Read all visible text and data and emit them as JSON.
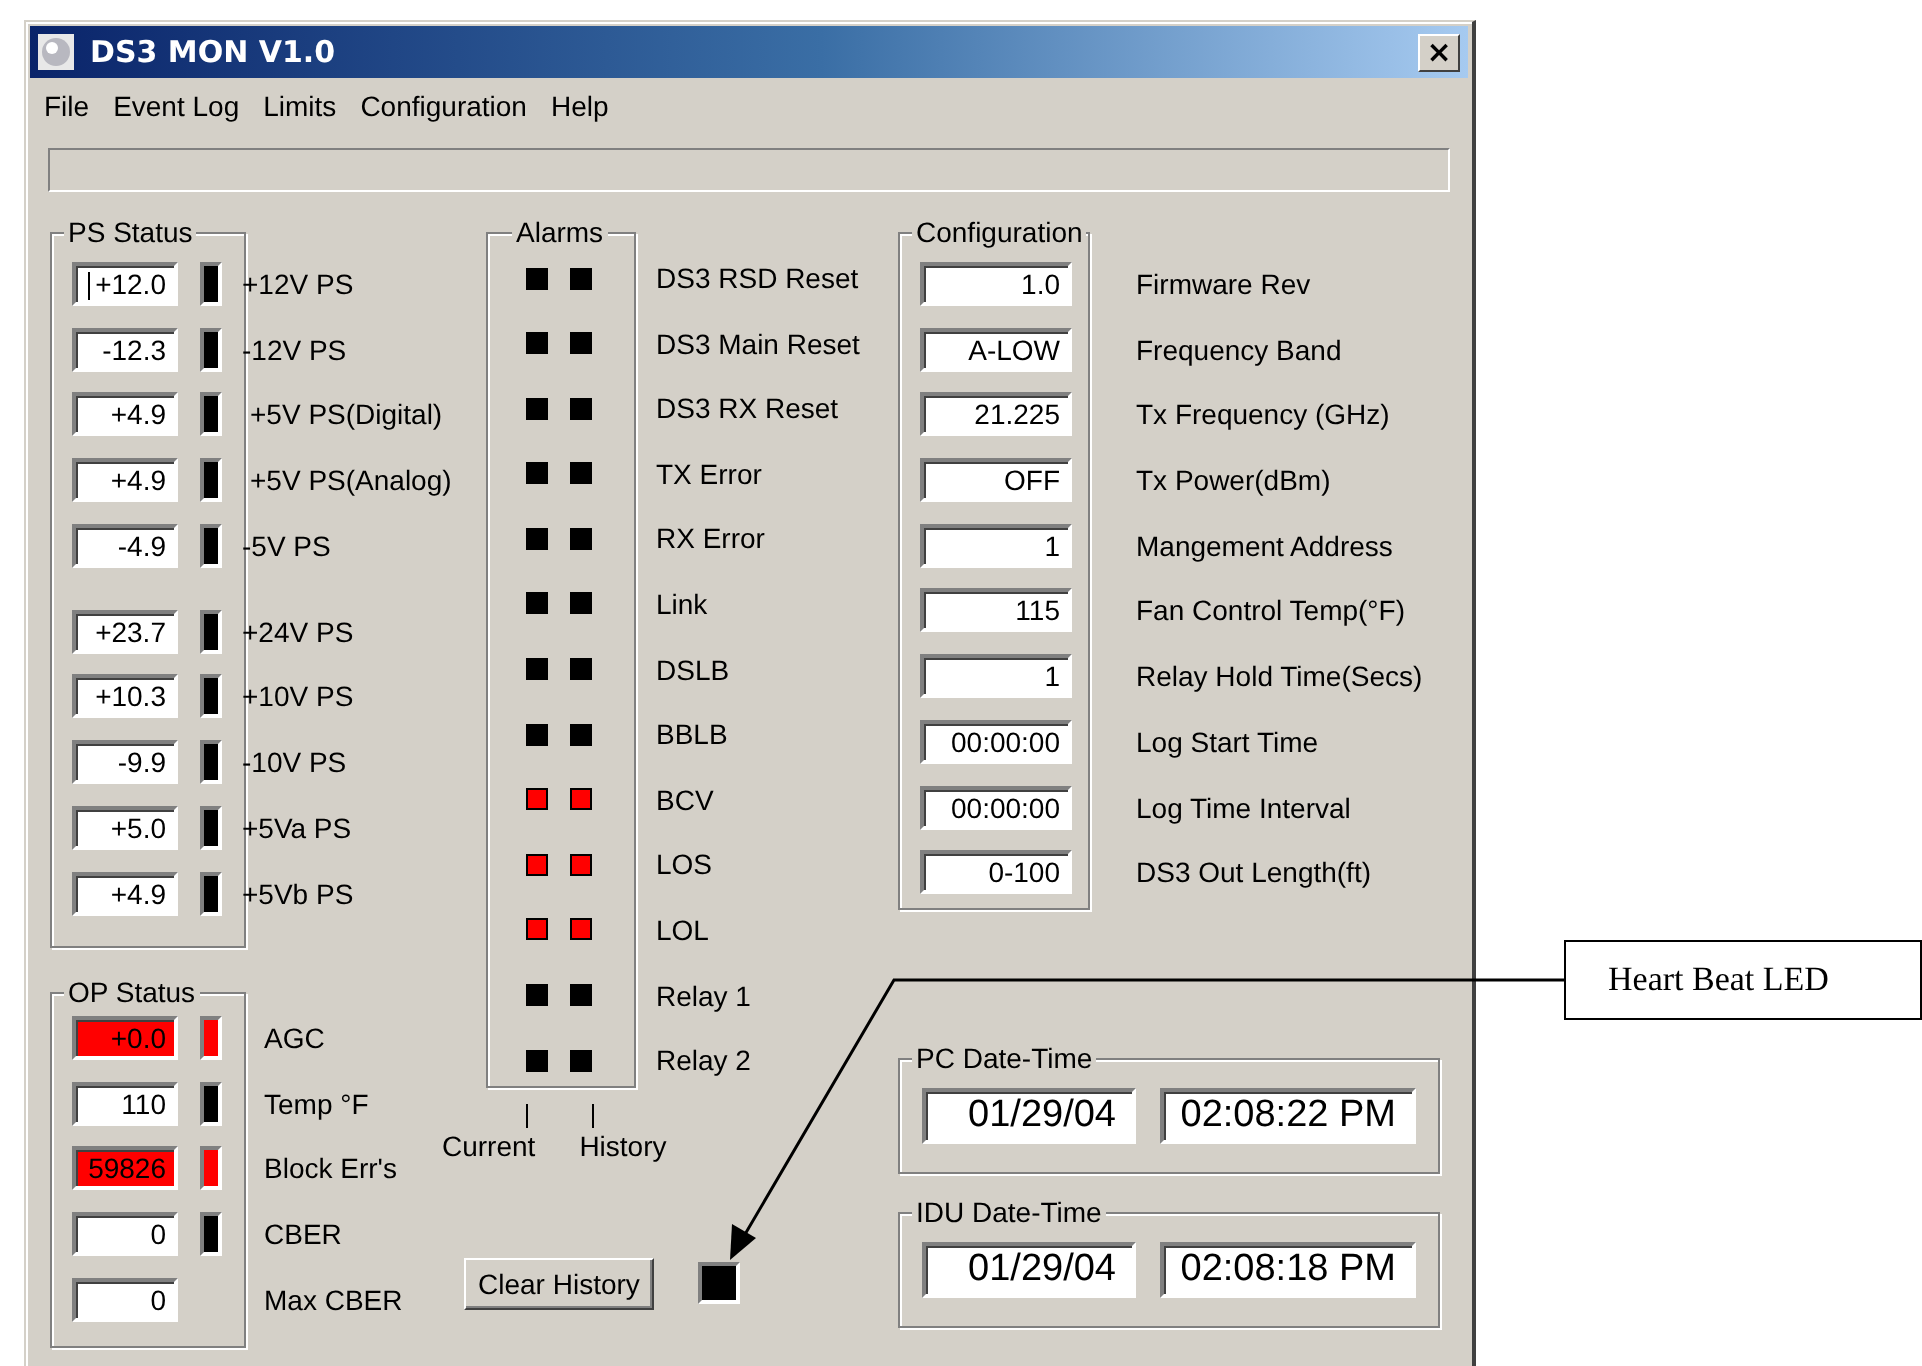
{
  "window": {
    "title": "DS3 MON V1.0",
    "close": "×"
  },
  "menu": [
    "File",
    "Event Log",
    "Limits",
    "Configuration",
    "Help"
  ],
  "ps_status": {
    "title": "PS Status",
    "banks": [
      [
        {
          "value": "+12.0",
          "label": "+12V PS",
          "alarm": false,
          "focused": true
        },
        {
          "value": "-12.3",
          "label": "-12V PS",
          "alarm": false,
          "focused": false
        },
        {
          "value": "+4.9",
          "label": "+5V PS(Digital)",
          "alarm": false,
          "focused": false
        },
        {
          "value": "+4.9",
          "label": "+5V PS(Analog)",
          "alarm": false,
          "focused": false
        },
        {
          "value": "-4.9",
          "label": "-5V PS",
          "alarm": false,
          "focused": false
        }
      ],
      [
        {
          "value": "+23.7",
          "label": "+24V PS",
          "alarm": false,
          "focused": false
        },
        {
          "value": "+10.3",
          "label": "+10V PS",
          "alarm": false,
          "focused": false
        },
        {
          "value": "-9.9",
          "label": "-10V PS",
          "alarm": false,
          "focused": false
        },
        {
          "value": "+5.0",
          "label": "+5Va PS",
          "alarm": false,
          "focused": false
        },
        {
          "value": "+4.9",
          "label": "+5Vb PS",
          "alarm": false,
          "focused": false
        }
      ]
    ]
  },
  "op_status": {
    "title": "OP Status",
    "rows": [
      {
        "kind": "led",
        "value": "+0.0",
        "label": "AGC",
        "alarm": true
      },
      {
        "kind": "led",
        "value": "110",
        "label": "Temp °F",
        "alarm": false
      },
      {
        "kind": "led",
        "value": "59826",
        "label": "Block Err's",
        "alarm": true
      },
      {
        "kind": "led",
        "value": "0",
        "label": "CBER",
        "alarm": false
      },
      {
        "kind": "plain",
        "value": "0",
        "label": "Max CBER",
        "alarm": false
      }
    ]
  },
  "alarms": {
    "title": "Alarms",
    "rows": [
      {
        "label": "DS3 RSD Reset",
        "current": false,
        "history": false
      },
      {
        "label": "DS3 Main Reset",
        "current": false,
        "history": false
      },
      {
        "label": "DS3 RX Reset",
        "current": false,
        "history": false
      },
      {
        "label": "TX Error",
        "current": false,
        "history": false
      },
      {
        "label": "RX Error",
        "current": false,
        "history": false
      },
      {
        "label": "Link",
        "current": false,
        "history": false
      },
      {
        "label": "DSLB",
        "current": false,
        "history": false
      },
      {
        "label": "BBLB",
        "current": false,
        "history": false
      },
      {
        "label": "BCV",
        "current": true,
        "history": true
      },
      {
        "label": "LOS",
        "current": true,
        "history": true
      },
      {
        "label": "LOL",
        "current": true,
        "history": true
      },
      {
        "label": "Relay 1",
        "current": false,
        "history": false
      },
      {
        "label": "Relay 2",
        "current": false,
        "history": false
      }
    ],
    "current_label": "Current",
    "history_label": "History"
  },
  "clear_button": "Clear History",
  "heartbeat_led": {
    "on": false
  },
  "configuration": {
    "title": "Configuration",
    "rows": [
      {
        "value": "1.0",
        "label": "Firmware Rev"
      },
      {
        "value": "A-LOW",
        "label": "Frequency Band"
      },
      {
        "value": "21.225",
        "label": "Tx Frequency (GHz)"
      },
      {
        "value": "OFF",
        "label": "Tx Power(dBm)"
      },
      {
        "value": "1",
        "label": "Mangement Address"
      },
      {
        "value": "115",
        "label": "Fan Control Temp(°F)"
      },
      {
        "value": "1",
        "label": "Relay Hold Time(Secs)"
      },
      {
        "value": "00:00:00",
        "label": "Log Start Time"
      },
      {
        "value": "00:00:00",
        "label": "Log Time Interval"
      },
      {
        "value": "0-100",
        "label": "DS3 Out Length(ft)"
      }
    ]
  },
  "date_times": [
    {
      "title": "PC Date-Time",
      "date": "01/29/04",
      "time": "02:08:22 PM"
    },
    {
      "title": "IDU Date-Time",
      "date": "01/29/04",
      "time": "02:08:18 PM"
    }
  ],
  "annotation": {
    "text": "Heart Beat LED"
  }
}
